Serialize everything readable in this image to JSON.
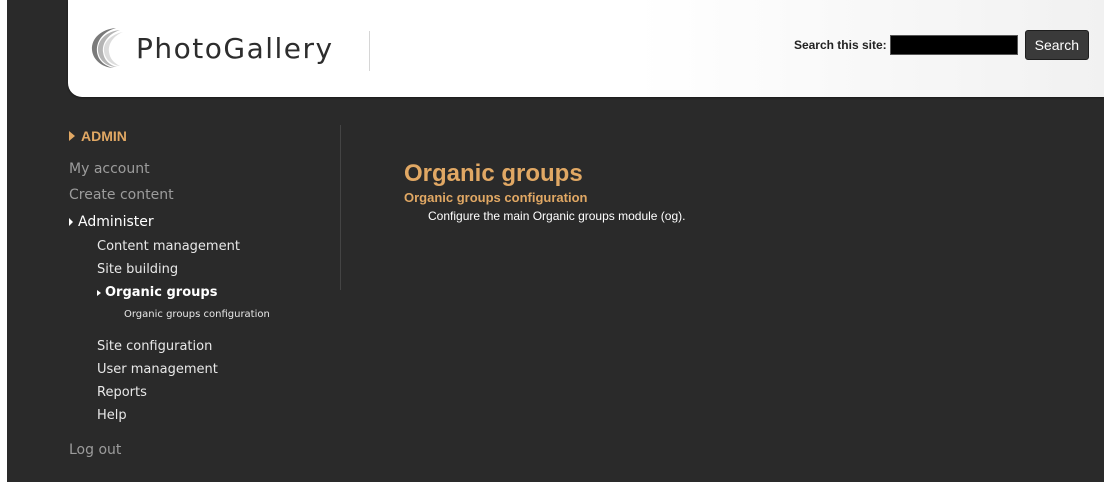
{
  "header": {
    "site_name": "PhotoGallery",
    "search_label": "Search this site:",
    "search_value": "",
    "search_button": "Search"
  },
  "sidebar": {
    "section_title": "ADMIN",
    "my_account": "My account",
    "create_content": "Create content",
    "administer": "Administer",
    "sub_items": [
      "Content management",
      "Site building"
    ],
    "active_item": "Organic groups",
    "active_child": "Organic groups configuration",
    "more_items": [
      "Site configuration",
      "User management",
      "Reports",
      "Help"
    ],
    "log_out": "Log out"
  },
  "main": {
    "title": "Organic groups",
    "link": "Organic groups configuration",
    "description": "Configure the main Organic groups module (og)."
  },
  "colors": {
    "accent": "#e1a864",
    "background": "#2a2a2a",
    "header_bg": "#ffffff"
  }
}
